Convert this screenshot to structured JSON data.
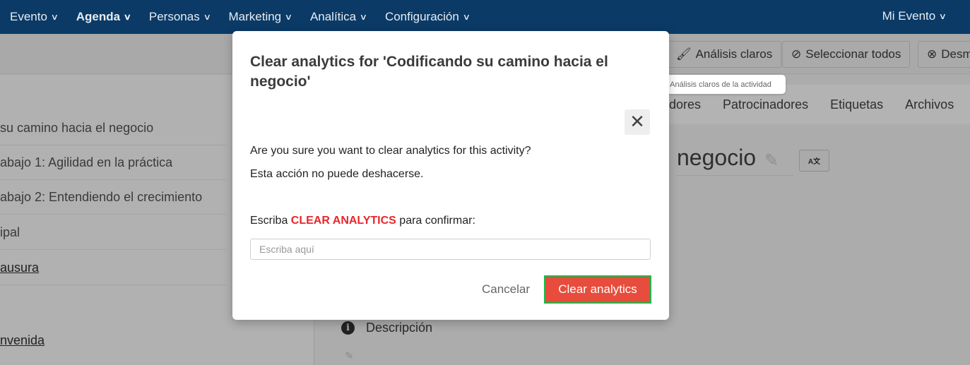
{
  "nav": {
    "items": [
      {
        "label": "Evento"
      },
      {
        "label": "Agenda"
      },
      {
        "label": "Personas"
      },
      {
        "label": "Marketing"
      },
      {
        "label": "Analítica"
      },
      {
        "label": "Configuración"
      }
    ],
    "right": "Mi Evento"
  },
  "toolbar": {
    "clear_analytics": "Análisis claros",
    "select_all": "Seleccionar todos",
    "deselect": "Desm"
  },
  "tooltip": "Análisis claros de la actividad",
  "sidebar": {
    "items": [
      "su camino hacia el negocio",
      "abajo 1: Agilidad en la práctica",
      "abajo 2: Entendiendo el crecimiento",
      "ipal",
      "ausura",
      "nvenida"
    ]
  },
  "tabs": [
    "dores",
    "Patrocinadores",
    "Etiquetas",
    "Archivos"
  ],
  "main": {
    "title": "negocio",
    "description": "Descripción"
  },
  "modal": {
    "title": "Clear analytics for 'Codificando su camino hacia el negocio'",
    "question": "Are you sure you want to clear analytics for this activity?",
    "warning": "Esta acción no puede deshacerse.",
    "confirm_prefix": "Escriba ",
    "confirm_keyword": "CLEAR ANALYTICS",
    "confirm_suffix": " para confirmar:",
    "input_placeholder": "Escriba aquí",
    "input_value": "",
    "cancel": "Cancelar",
    "submit": "Clear analytics"
  },
  "colors": {
    "nav": "#0b3a66",
    "danger": "#e74c3c",
    "keyword": "#e8262a",
    "focus": "#1fb84a"
  }
}
